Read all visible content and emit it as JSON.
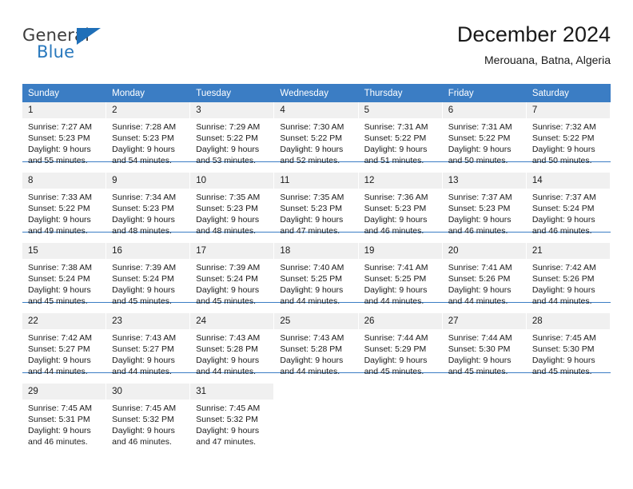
{
  "brand": {
    "name_top": "General",
    "name_bottom": "Blue",
    "accent_color": "#1f6fb8",
    "top_color": "#3c3c3c"
  },
  "header": {
    "title": "December 2024",
    "subtitle": "Merouana, Batna, Algeria"
  },
  "theme": {
    "header_bg": "#3b7dc4",
    "daynum_bg": "#f0f0f0",
    "separator": "#3b7dc4",
    "text": "#1a1a1a"
  },
  "weekday_headers": [
    "Sunday",
    "Monday",
    "Tuesday",
    "Wednesday",
    "Thursday",
    "Friday",
    "Saturday"
  ],
  "labels": {
    "sunrise_prefix": "Sunrise:",
    "sunset_prefix": "Sunset:",
    "daylight_prefix": "Daylight:"
  },
  "weeks": [
    {
      "days": [
        {
          "num": "1",
          "sunrise": "Sunrise: 7:27 AM",
          "sunset": "Sunset: 5:23 PM",
          "daylight_1": "Daylight: 9 hours",
          "daylight_2": "and 55 minutes."
        },
        {
          "num": "2",
          "sunrise": "Sunrise: 7:28 AM",
          "sunset": "Sunset: 5:23 PM",
          "daylight_1": "Daylight: 9 hours",
          "daylight_2": "and 54 minutes."
        },
        {
          "num": "3",
          "sunrise": "Sunrise: 7:29 AM",
          "sunset": "Sunset: 5:22 PM",
          "daylight_1": "Daylight: 9 hours",
          "daylight_2": "and 53 minutes."
        },
        {
          "num": "4",
          "sunrise": "Sunrise: 7:30 AM",
          "sunset": "Sunset: 5:22 PM",
          "daylight_1": "Daylight: 9 hours",
          "daylight_2": "and 52 minutes."
        },
        {
          "num": "5",
          "sunrise": "Sunrise: 7:31 AM",
          "sunset": "Sunset: 5:22 PM",
          "daylight_1": "Daylight: 9 hours",
          "daylight_2": "and 51 minutes."
        },
        {
          "num": "6",
          "sunrise": "Sunrise: 7:31 AM",
          "sunset": "Sunset: 5:22 PM",
          "daylight_1": "Daylight: 9 hours",
          "daylight_2": "and 50 minutes."
        },
        {
          "num": "7",
          "sunrise": "Sunrise: 7:32 AM",
          "sunset": "Sunset: 5:22 PM",
          "daylight_1": "Daylight: 9 hours",
          "daylight_2": "and 50 minutes."
        }
      ]
    },
    {
      "days": [
        {
          "num": "8",
          "sunrise": "Sunrise: 7:33 AM",
          "sunset": "Sunset: 5:22 PM",
          "daylight_1": "Daylight: 9 hours",
          "daylight_2": "and 49 minutes."
        },
        {
          "num": "9",
          "sunrise": "Sunrise: 7:34 AM",
          "sunset": "Sunset: 5:23 PM",
          "daylight_1": "Daylight: 9 hours",
          "daylight_2": "and 48 minutes."
        },
        {
          "num": "10",
          "sunrise": "Sunrise: 7:35 AM",
          "sunset": "Sunset: 5:23 PM",
          "daylight_1": "Daylight: 9 hours",
          "daylight_2": "and 48 minutes."
        },
        {
          "num": "11",
          "sunrise": "Sunrise: 7:35 AM",
          "sunset": "Sunset: 5:23 PM",
          "daylight_1": "Daylight: 9 hours",
          "daylight_2": "and 47 minutes."
        },
        {
          "num": "12",
          "sunrise": "Sunrise: 7:36 AM",
          "sunset": "Sunset: 5:23 PM",
          "daylight_1": "Daylight: 9 hours",
          "daylight_2": "and 46 minutes."
        },
        {
          "num": "13",
          "sunrise": "Sunrise: 7:37 AM",
          "sunset": "Sunset: 5:23 PM",
          "daylight_1": "Daylight: 9 hours",
          "daylight_2": "and 46 minutes."
        },
        {
          "num": "14",
          "sunrise": "Sunrise: 7:37 AM",
          "sunset": "Sunset: 5:24 PM",
          "daylight_1": "Daylight: 9 hours",
          "daylight_2": "and 46 minutes."
        }
      ]
    },
    {
      "days": [
        {
          "num": "15",
          "sunrise": "Sunrise: 7:38 AM",
          "sunset": "Sunset: 5:24 PM",
          "daylight_1": "Daylight: 9 hours",
          "daylight_2": "and 45 minutes."
        },
        {
          "num": "16",
          "sunrise": "Sunrise: 7:39 AM",
          "sunset": "Sunset: 5:24 PM",
          "daylight_1": "Daylight: 9 hours",
          "daylight_2": "and 45 minutes."
        },
        {
          "num": "17",
          "sunrise": "Sunrise: 7:39 AM",
          "sunset": "Sunset: 5:24 PM",
          "daylight_1": "Daylight: 9 hours",
          "daylight_2": "and 45 minutes."
        },
        {
          "num": "18",
          "sunrise": "Sunrise: 7:40 AM",
          "sunset": "Sunset: 5:25 PM",
          "daylight_1": "Daylight: 9 hours",
          "daylight_2": "and 44 minutes."
        },
        {
          "num": "19",
          "sunrise": "Sunrise: 7:41 AM",
          "sunset": "Sunset: 5:25 PM",
          "daylight_1": "Daylight: 9 hours",
          "daylight_2": "and 44 minutes."
        },
        {
          "num": "20",
          "sunrise": "Sunrise: 7:41 AM",
          "sunset": "Sunset: 5:26 PM",
          "daylight_1": "Daylight: 9 hours",
          "daylight_2": "and 44 minutes."
        },
        {
          "num": "21",
          "sunrise": "Sunrise: 7:42 AM",
          "sunset": "Sunset: 5:26 PM",
          "daylight_1": "Daylight: 9 hours",
          "daylight_2": "and 44 minutes."
        }
      ]
    },
    {
      "days": [
        {
          "num": "22",
          "sunrise": "Sunrise: 7:42 AM",
          "sunset": "Sunset: 5:27 PM",
          "daylight_1": "Daylight: 9 hours",
          "daylight_2": "and 44 minutes."
        },
        {
          "num": "23",
          "sunrise": "Sunrise: 7:43 AM",
          "sunset": "Sunset: 5:27 PM",
          "daylight_1": "Daylight: 9 hours",
          "daylight_2": "and 44 minutes."
        },
        {
          "num": "24",
          "sunrise": "Sunrise: 7:43 AM",
          "sunset": "Sunset: 5:28 PM",
          "daylight_1": "Daylight: 9 hours",
          "daylight_2": "and 44 minutes."
        },
        {
          "num": "25",
          "sunrise": "Sunrise: 7:43 AM",
          "sunset": "Sunset: 5:28 PM",
          "daylight_1": "Daylight: 9 hours",
          "daylight_2": "and 44 minutes."
        },
        {
          "num": "26",
          "sunrise": "Sunrise: 7:44 AM",
          "sunset": "Sunset: 5:29 PM",
          "daylight_1": "Daylight: 9 hours",
          "daylight_2": "and 45 minutes."
        },
        {
          "num": "27",
          "sunrise": "Sunrise: 7:44 AM",
          "sunset": "Sunset: 5:30 PM",
          "daylight_1": "Daylight: 9 hours",
          "daylight_2": "and 45 minutes."
        },
        {
          "num": "28",
          "sunrise": "Sunrise: 7:45 AM",
          "sunset": "Sunset: 5:30 PM",
          "daylight_1": "Daylight: 9 hours",
          "daylight_2": "and 45 minutes."
        }
      ]
    },
    {
      "days": [
        {
          "num": "29",
          "sunrise": "Sunrise: 7:45 AM",
          "sunset": "Sunset: 5:31 PM",
          "daylight_1": "Daylight: 9 hours",
          "daylight_2": "and 46 minutes."
        },
        {
          "num": "30",
          "sunrise": "Sunrise: 7:45 AM",
          "sunset": "Sunset: 5:32 PM",
          "daylight_1": "Daylight: 9 hours",
          "daylight_2": "and 46 minutes."
        },
        {
          "num": "31",
          "sunrise": "Sunrise: 7:45 AM",
          "sunset": "Sunset: 5:32 PM",
          "daylight_1": "Daylight: 9 hours",
          "daylight_2": "and 47 minutes."
        },
        {
          "num": "",
          "sunrise": "",
          "sunset": "",
          "daylight_1": "",
          "daylight_2": ""
        },
        {
          "num": "",
          "sunrise": "",
          "sunset": "",
          "daylight_1": "",
          "daylight_2": ""
        },
        {
          "num": "",
          "sunrise": "",
          "sunset": "",
          "daylight_1": "",
          "daylight_2": ""
        },
        {
          "num": "",
          "sunrise": "",
          "sunset": "",
          "daylight_1": "",
          "daylight_2": ""
        }
      ]
    }
  ]
}
